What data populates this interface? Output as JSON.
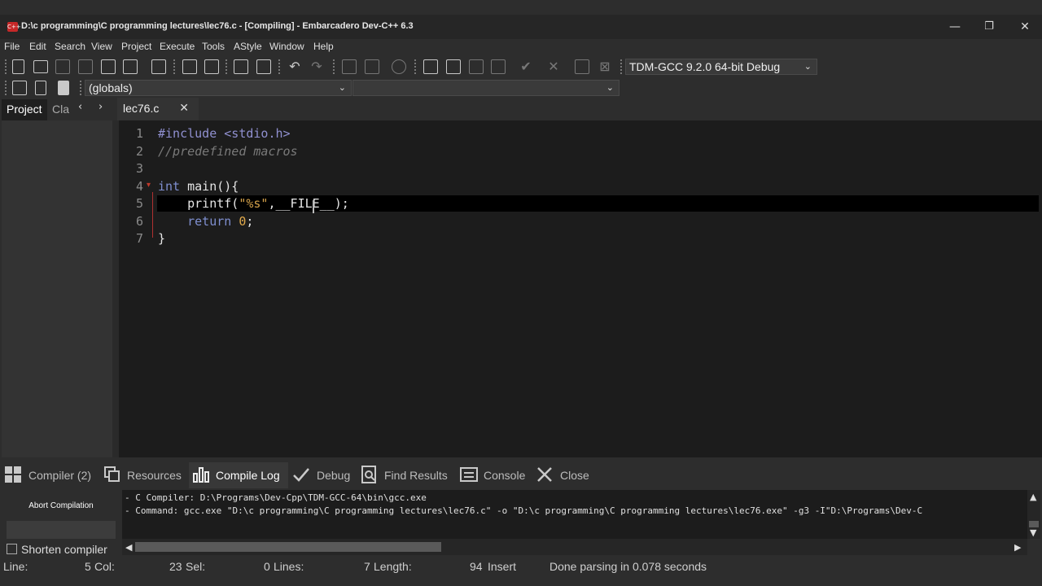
{
  "window": {
    "title": "D:\\c programming\\C programming lectures\\lec76.c - [Compiling] - Embarcadero Dev-C++ 6.3",
    "app_icon_label": "C++",
    "minimize": "—",
    "restore": "❐",
    "close": "✕"
  },
  "menu": [
    "File",
    "Edit",
    "Search",
    "View",
    "Project",
    "Execute",
    "Tools",
    "AStyle",
    "Window",
    "Help"
  ],
  "toolbar": {
    "compiler_select": "TDM-GCC 9.2.0 64-bit Debug",
    "scope_select": "(globals)",
    "function_select": ""
  },
  "side_tabs": {
    "project": "Project",
    "classes": "Cla",
    "prev": "‹",
    "next": "›"
  },
  "editor_tab": {
    "label": "lec76.c",
    "close": "✕"
  },
  "code": {
    "line_numbers": [
      "1",
      "2",
      "3",
      "4",
      "5",
      "6",
      "7"
    ],
    "line1_directive": "#include <stdio.h>",
    "line2_comment": "//predefined macros",
    "line4_kw": "int",
    "line4_rest": " main(){",
    "line5_indent": "    ",
    "line5_fn": "printf(",
    "line5_str": "\"%s\"",
    "line5_rest": ",__FILE__);",
    "line6_indent": "    ",
    "line6_kw": "return",
    "line6_sp": " ",
    "line6_num": "0",
    "line6_semi": ";",
    "line7": "}"
  },
  "bottom_tabs": {
    "compiler": "Compiler (2)",
    "resources": "Resources",
    "compile_log": "Compile Log",
    "debug": "Debug",
    "find_results": "Find Results",
    "console": "Console",
    "close": "Close"
  },
  "log_panel": {
    "abort_button": "Abort Compilation",
    "shorten_checkbox": "Shorten compiler",
    "lines": [
      "- C Compiler: D:\\Programs\\Dev-Cpp\\TDM-GCC-64\\bin\\gcc.exe",
      "- Command: gcc.exe \"D:\\c programming\\C programming lectures\\lec76.c\" -o \"D:\\c programming\\C programming lectures\\lec76.exe\" -g3 -I\"D:\\Programs\\Dev-C"
    ]
  },
  "status": {
    "line_label": "Line:",
    "line_value": "5",
    "col_label": "Col:",
    "col_value": "23",
    "sel_label": "Sel:",
    "sel_value": "0",
    "lines_label": "Lines:",
    "lines_value": "7",
    "length_label": "Length:",
    "length_value": "94",
    "mode": "Insert",
    "message": "Done parsing in 0.078 seconds"
  },
  "colors": {
    "editor_bg": "#1c1c1c",
    "current_line": "#000000",
    "keyword": "#7f8fd0",
    "string": "#d5a24a",
    "comment": "#7a7a7a"
  }
}
